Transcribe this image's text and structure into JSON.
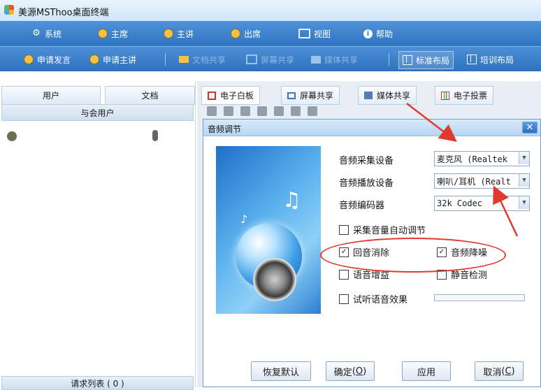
{
  "window": {
    "title": "美源MSThoo桌面终端"
  },
  "menu": {
    "items": [
      {
        "label": "系统",
        "icon": "gear-icon"
      },
      {
        "label": "主席",
        "icon": "user-icon"
      },
      {
        "label": "主讲",
        "icon": "user-icon"
      },
      {
        "label": "出席",
        "icon": "user-icon"
      },
      {
        "label": "视图",
        "icon": "monitor-icon"
      },
      {
        "label": "帮助",
        "icon": "help-icon"
      }
    ]
  },
  "toolbar": {
    "request_speak": "申请发言",
    "request_present": "申请主讲",
    "file_share": "文档共享",
    "screen_share": "屏幕共享",
    "media_share": "媒体共享",
    "standard_layout": "标准布局",
    "training_layout": "培训布局"
  },
  "left_panel": {
    "tabs": [
      "用户",
      "文档"
    ],
    "header": "与会用户",
    "request_list": "请求列表 ( 0 )"
  },
  "main_tabs": [
    "电子白板",
    "屏幕共享",
    "媒体共享",
    "电子投票"
  ],
  "dialog": {
    "title": "音频调节",
    "capture_device_label": "音频采集设备",
    "capture_device_value": "麦克风 (Realtek",
    "playback_device_label": "音频播放设备",
    "playback_device_value": "喇叭/耳机 (Realt",
    "codec_label": "音频编码器",
    "codec_value": "32k Codec",
    "checkboxes": {
      "auto_gain": {
        "label": "采集音量自动调节",
        "checked": false
      },
      "echo_cancel": {
        "label": "回音消除",
        "checked": true
      },
      "noise_reduce": {
        "label": "音频降噪",
        "checked": true
      },
      "voice_boost": {
        "label": "语音增益",
        "checked": false
      },
      "silence_detect": {
        "label": "静音检测",
        "checked": false
      },
      "preview": {
        "label": "试听语音效果",
        "checked": false
      }
    },
    "buttons": {
      "restore_default": "恢复默认",
      "ok": "确定",
      "ok_key": "O",
      "apply": "应用",
      "cancel": "取消",
      "cancel_key": "C"
    }
  },
  "colors": {
    "menubar": "#2f74c2",
    "annotation": "#e03a2e"
  }
}
